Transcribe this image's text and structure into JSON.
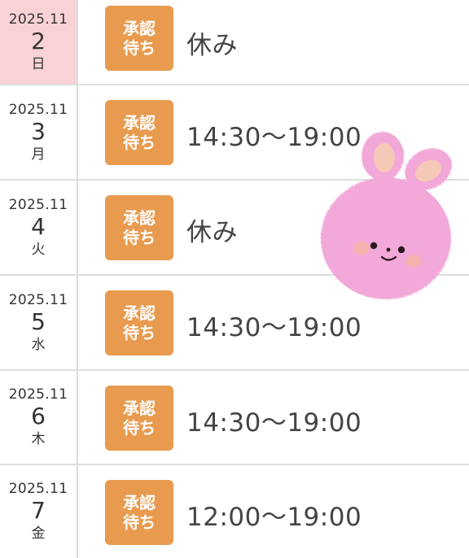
{
  "rows": [
    {
      "ym": "2025.11",
      "day": "2",
      "dow": "日",
      "badge_line1": "承認",
      "badge_line2": "待ち",
      "shift": "休み",
      "sunday": true
    },
    {
      "ym": "2025.11",
      "day": "3",
      "dow": "月",
      "badge_line1": "承認",
      "badge_line2": "待ち",
      "shift": "14:30〜19:00",
      "sunday": false
    },
    {
      "ym": "2025.11",
      "day": "4",
      "dow": "火",
      "badge_line1": "承認",
      "badge_line2": "待ち",
      "shift": "休み",
      "sunday": false
    },
    {
      "ym": "2025.11",
      "day": "5",
      "dow": "水",
      "badge_line1": "承認",
      "badge_line2": "待ち",
      "shift": "14:30〜19:00",
      "sunday": false
    },
    {
      "ym": "2025.11",
      "day": "6",
      "dow": "木",
      "badge_line1": "承認",
      "badge_line2": "待ち",
      "shift": "14:30〜19:00",
      "sunday": false
    },
    {
      "ym": "2025.11",
      "day": "7",
      "dow": "金",
      "badge_line1": "承認",
      "badge_line2": "待ち",
      "shift": "12:00〜19:00",
      "sunday": false
    }
  ],
  "colors": {
    "badge": "#e89b4f",
    "sunday_bg": "#f9d2d6",
    "divider": "#dddddd"
  },
  "decoration": {
    "icon": "pink-bunny-sticker"
  }
}
